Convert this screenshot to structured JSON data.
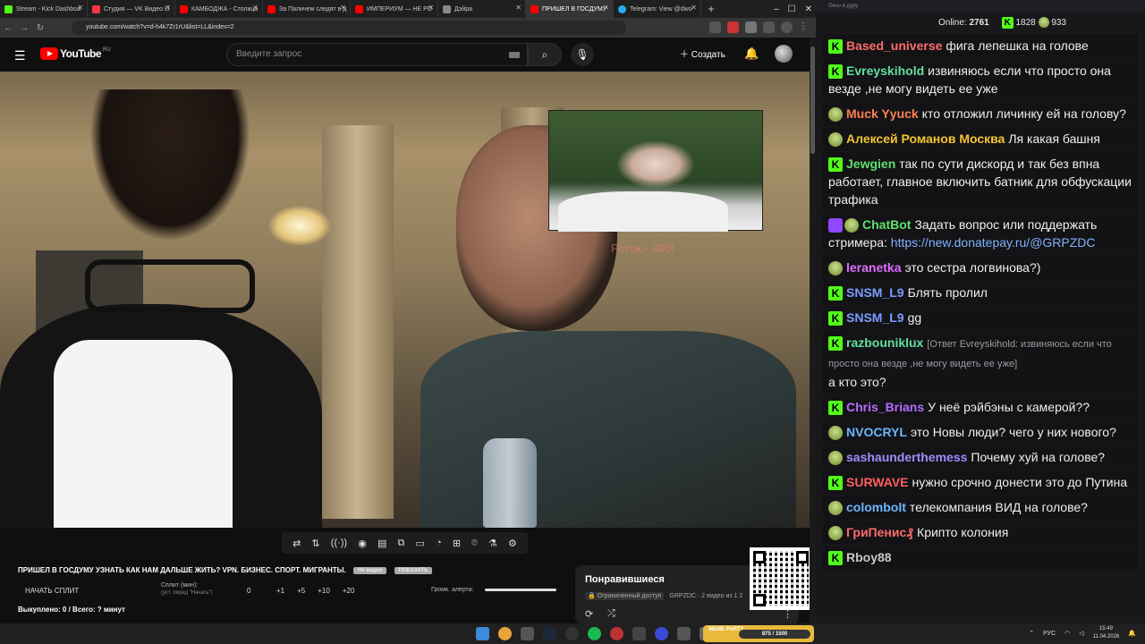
{
  "browser": {
    "tabs": [
      {
        "label": "Stream - Kick Dashboa",
        "color": "#53fc18",
        "active": false
      },
      {
        "label": "Студия — VK Видео Li",
        "color": "#ff3347",
        "active": false
      },
      {
        "label": "КАМБОДЖА - Столица",
        "color": "#ff0000",
        "active": false
      },
      {
        "label": "За Паличем следят в д",
        "color": "#ff0000",
        "active": false
      },
      {
        "label": "ИМПЕРИУМ — НЕ РО",
        "color": "#ff0000",
        "active": false
      },
      {
        "label": "Дэйра",
        "color": "#888888",
        "active": false
      },
      {
        "label": "ПРИШЕЛ В ГОСДУМУ",
        "color": "#ff0000",
        "active": true
      },
      {
        "label": "Telegram: View @dwo",
        "color": "#2aabee",
        "active": false
      }
    ],
    "url": "youtube.com/watch?v=d-h4k7Zr1rU&list=LL&index=2"
  },
  "youtube": {
    "logo_text": "YouTube",
    "logo_region": "RU",
    "search_placeholder": "Введите запрос",
    "create_label": "Создать"
  },
  "video": {
    "overlay_text": "Роток - 300!",
    "title": "ПРИШЕЛ В ГОСДУМУ УЗНАТЬ КАК НАМ ДАЛЬШЕ ЖИТЬ? VPN. БИЗНЕС. СПОРТ. МИГРАНТЫ.",
    "pill1": "Не видео",
    "pill2": "ПОКАЗАТЬ"
  },
  "split": {
    "start_label": "НАЧАТЬ СПЛИТ",
    "minutes_label": "Сплит (мин):",
    "minutes_hint": "(уст. перед \"Начать\")",
    "value": "0",
    "inc1": "+1",
    "inc2": "+5",
    "inc3": "+10",
    "inc4": "+20",
    "alert_volume_label": "Громк. алерта:",
    "bought_text": "Выкуплено: 0 / Всего: ? минут"
  },
  "liked": {
    "title": "Понравившиеся",
    "access": "Ограниченный доступ",
    "meta": "GRPZDC · 2 видео из 1 2"
  },
  "chat": {
    "header": "Окно в дуру",
    "online_label": "Online:",
    "online_count": "2761",
    "kick_count": "1828",
    "other_count": "933",
    "messages": [
      {
        "badge": "k",
        "user": "Based_universe",
        "color": "#ff6b6b",
        "text": "фига лепешка на голове"
      },
      {
        "badge": "k",
        "user": "Evreyskihold",
        "color": "#5fe0a2",
        "text": "извиняюсь если что просто она везде ,не могу видеть ее уже"
      },
      {
        "badge": "g",
        "user": "Muck Yyuck",
        "color": "#ff7f50",
        "text": "кто отложил личинку ей на голову?"
      },
      {
        "badge": "g",
        "user": "Алексей Романов Москва",
        "color": "#f4c430",
        "text": "Ля какая башня"
      },
      {
        "badge": "k",
        "user": "Jewgien",
        "color": "#5fe06b",
        "text": "так по сути дискорд и так без впна работает, главное включить батник для обфускации трафика"
      },
      {
        "badge": "v",
        "user": "ChatBot",
        "color": "#5fe06b",
        "text": "Задать вопрос или поддержать стримера:",
        "link": "https://new.donatepay.ru/@GRPZDC"
      },
      {
        "badge": "g",
        "user": "leranetka",
        "color": "#e06bff",
        "text": "это сестра логвинова?)"
      },
      {
        "badge": "k",
        "user": "SNSM_L9",
        "color": "#7b9cff",
        "text": "Блять пролил"
      },
      {
        "badge": "k",
        "user": "SNSM_L9",
        "color": "#7b9cff",
        "text": "gg"
      },
      {
        "badge": "k",
        "user": "razbouniklux",
        "color": "#5fe0a2",
        "reply": "[Ответ Evreyskihold: извиняюсь если что просто она везде ,не могу видеть ее уже]",
        "text": "а кто это?"
      },
      {
        "badge": "k",
        "user": "Chris_Brians",
        "color": "#b56bff",
        "text": "У неё рэйбэны с камерой??"
      },
      {
        "badge": "g",
        "user": "NVOCRYL",
        "color": "#6bb6ff",
        "text": "это Новы люди? чего у них нового?"
      },
      {
        "badge": "g",
        "user": "sashaunderthemess",
        "color": "#a38bff",
        "text": "Почему хуй на голове?"
      },
      {
        "badge": "k",
        "user": "SURWAVE",
        "color": "#ff5f5f",
        "text": "нужно срочно донести это до Путина"
      },
      {
        "badge": "g",
        "user": "colombolt",
        "color": "#6bb6ff",
        "text": "телекомпания ВИД на голове?"
      },
      {
        "badge": "g",
        "user": "ГриПенис₰",
        "color": "#ff6b6b",
        "text": "Крипто колония"
      },
      {
        "badge": "k",
        "user": "Rboy88",
        "color": "#c8c8c8",
        "text": ""
      }
    ]
  },
  "taskbar": {
    "meme_label": "MEME PARTY",
    "meme_progress": "875 / 1500",
    "lang": "РУС",
    "time": "15:49",
    "date": "11.04.2026"
  }
}
